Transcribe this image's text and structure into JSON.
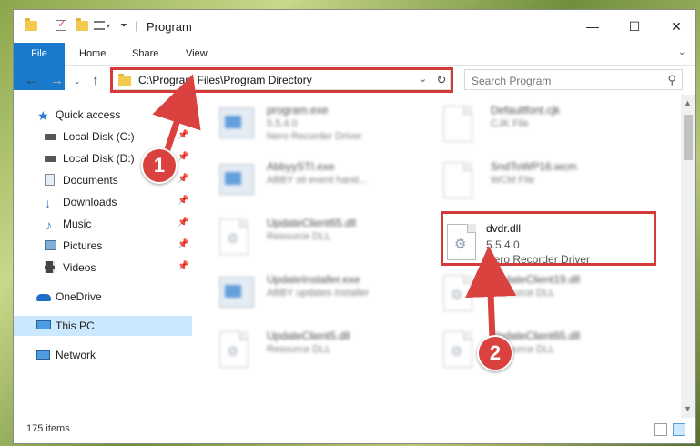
{
  "window": {
    "title": "Program",
    "controls": {
      "minimize": "—",
      "maximize": "☐",
      "close": "✕"
    }
  },
  "ribbon": {
    "tabs": [
      "File",
      "Home",
      "Share",
      "View"
    ]
  },
  "address": {
    "path": "C:\\Program Files\\Program Directory",
    "search_placeholder": "Search Program"
  },
  "sidebar": {
    "items": [
      {
        "label": "Quick access",
        "icon": "star-icon",
        "pinned": false
      },
      {
        "label": "Local Disk (C:)",
        "icon": "drive-icon",
        "pinned": true
      },
      {
        "label": "Local Disk (D:)",
        "icon": "drive-icon",
        "pinned": true
      },
      {
        "label": "Documents",
        "icon": "documents-icon",
        "pinned": true
      },
      {
        "label": "Downloads",
        "icon": "download-icon",
        "pinned": true
      },
      {
        "label": "Music",
        "icon": "music-icon",
        "pinned": true
      },
      {
        "label": "Pictures",
        "icon": "pictures-icon",
        "pinned": true
      },
      {
        "label": "Videos",
        "icon": "videos-icon",
        "pinned": true
      },
      {
        "label": "OneDrive",
        "icon": "cloud-icon",
        "pinned": false
      },
      {
        "label": "This PC",
        "icon": "computer-icon",
        "pinned": false
      },
      {
        "label": "Network",
        "icon": "network-icon",
        "pinned": false
      }
    ]
  },
  "files": [
    {
      "name": "program.exe",
      "meta1": "5.5.4.0",
      "meta2": "Nero Recorder Driver",
      "icon": "app-icon"
    },
    {
      "name": "Defaultfont.cjk",
      "meta1": "CJK File",
      "meta2": "",
      "icon": "document-icon"
    },
    {
      "name": "AbbyySTI.exe",
      "meta1": "ABBY sti event hand...",
      "meta2": "",
      "icon": "app-icon"
    },
    {
      "name": "SndToWP16.wcm",
      "meta1": "WCM File",
      "meta2": "",
      "icon": "document-icon"
    },
    {
      "name": "UpdateClient65.dll",
      "meta1": "Resource DLL",
      "meta2": "",
      "icon": "dll-icon"
    },
    {
      "name": "dvdr.dll",
      "meta1": "5.5.4.0",
      "meta2": "Nero Recorder Driver",
      "icon": "dll-icon"
    },
    {
      "name": "UpdateInstaller.exe",
      "meta1": "ABBY updates installer",
      "meta2": "",
      "icon": "app-icon"
    },
    {
      "name": "UpdateClient19.dll",
      "meta1": "Resource DLL",
      "meta2": "",
      "icon": "dll-icon"
    },
    {
      "name": "UpdateClient5.dll",
      "meta1": "Resource DLL",
      "meta2": "",
      "icon": "dll-icon"
    },
    {
      "name": "UpdateClient65.dll",
      "meta1": "Resource DLL",
      "meta2": "",
      "icon": "dll-icon"
    }
  ],
  "status": {
    "count": "175 items"
  },
  "annotations": {
    "step1": "1",
    "step2": "2",
    "highlight_color": "#d33a3a"
  }
}
